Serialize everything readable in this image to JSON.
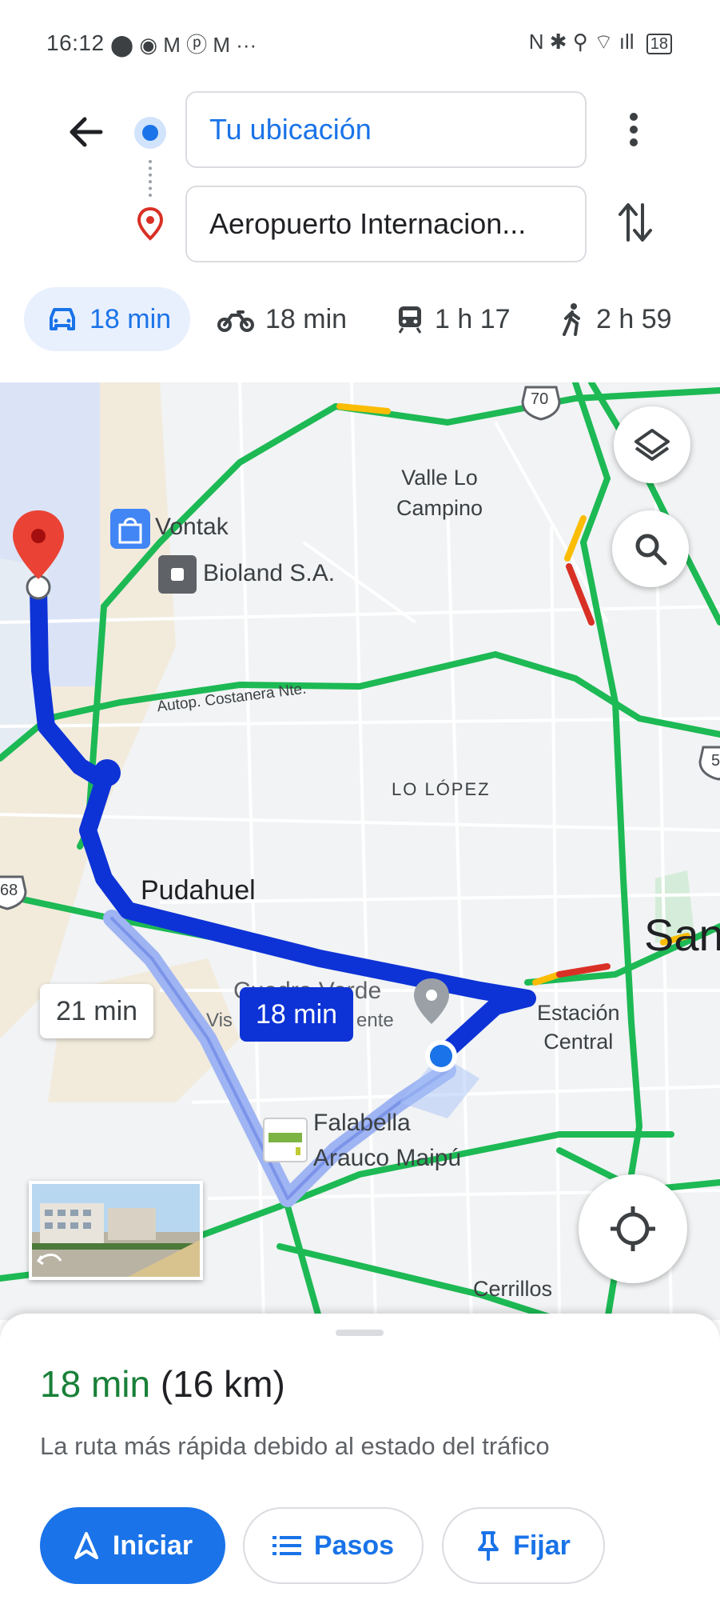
{
  "status_bar": {
    "time": "16:12",
    "notification_icons": "⬤ ◉ M ⓟ M ···",
    "system_icons": "N ✱ ⚲ ⌔ ıll",
    "battery": "18"
  },
  "directions": {
    "origin": "Tu ubicación",
    "destination": "Aeropuerto Internacion..."
  },
  "modes": [
    {
      "icon": "car-icon",
      "label": "18 min",
      "active": true
    },
    {
      "icon": "motorcycle-icon",
      "label": "18 min",
      "active": false
    },
    {
      "icon": "train-icon",
      "label": "1 h 17",
      "active": false
    },
    {
      "icon": "walk-icon",
      "label": "2 h 59",
      "active": false
    }
  ],
  "map": {
    "labels": {
      "valle_lo_campino": "Valle Lo\nCampino",
      "vontak": "Vontak",
      "bioland": "Bioland S.A.",
      "costanera": "Autop. Costanera Nte.",
      "lo_lopez": "LO LÓPEZ",
      "pudahuel": "Pudahuel",
      "santiago_partial": "San",
      "cuadro_verde": "Cuadro Verde",
      "vista_partial": "Vis",
      "ente_partial": "ente",
      "estacion_central": "Estación\nCentral",
      "falabella": "Falabella\nArauco Maipú",
      "cerrillos": "Cerrillos",
      "route_70": "70",
      "route_68": "68",
      "route_5": "5"
    },
    "alt_route_time": "21 min",
    "main_route_time": "18 min"
  },
  "summary": {
    "duration": "18 min",
    "distance": "(16 km)",
    "note": "La ruta más rápida debido al estado del tráfico"
  },
  "actions": {
    "start": "Iniciar",
    "steps": "Pasos",
    "pin": "Fijar"
  },
  "colors": {
    "accent_blue": "#1a73e8",
    "route_blue": "#0d33d6",
    "traffic_green": "#1db954",
    "traffic_yellow": "#fbbc04",
    "traffic_red": "#d93025",
    "duration_green": "#188038"
  }
}
